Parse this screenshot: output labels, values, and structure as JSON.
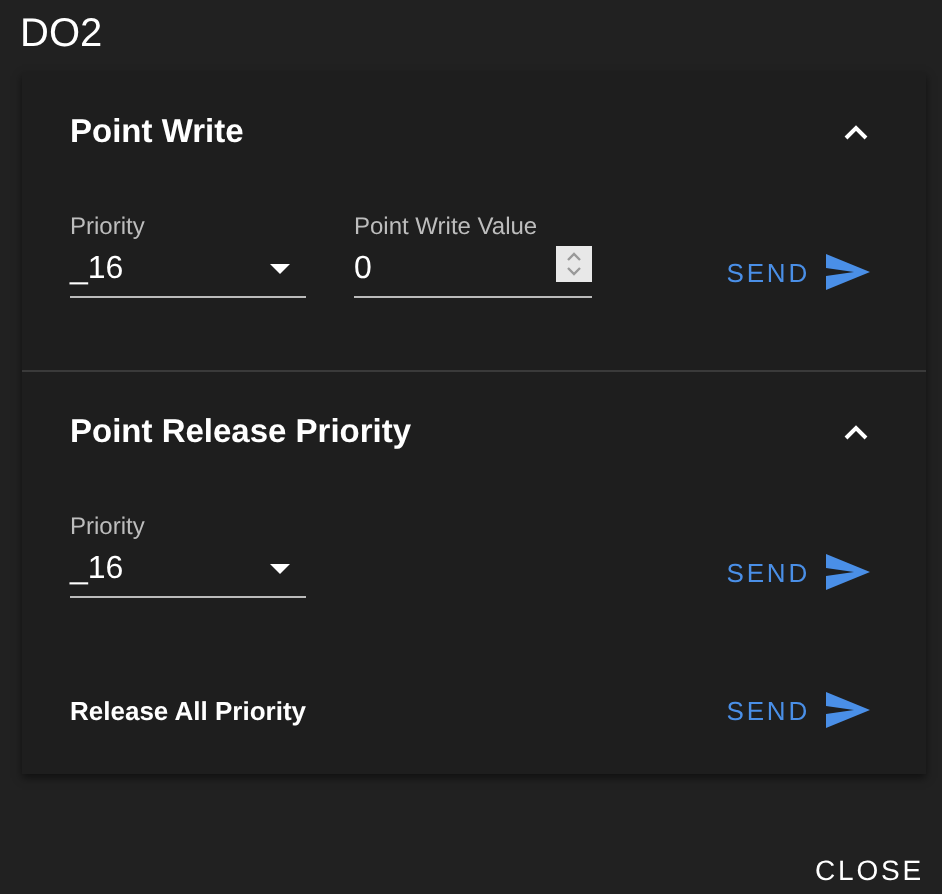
{
  "dialog": {
    "title": "DO2"
  },
  "panels": [
    {
      "title": "Point Write",
      "expanded": true,
      "rows": [
        {
          "kind": "fields",
          "fields": [
            {
              "kind": "select",
              "label": "Priority",
              "value": "_16"
            },
            {
              "kind": "number",
              "label": "Point Write Value",
              "value": "0"
            }
          ],
          "action": "SEND"
        }
      ]
    },
    {
      "title": "Point Release Priority",
      "expanded": true,
      "rows": [
        {
          "kind": "fields",
          "fields": [
            {
              "kind": "select",
              "label": "Priority",
              "value": "_16"
            }
          ],
          "action": "SEND"
        },
        {
          "kind": "text",
          "text": "Release All Priority",
          "action": "SEND"
        }
      ]
    }
  ],
  "close": "CLOSE"
}
